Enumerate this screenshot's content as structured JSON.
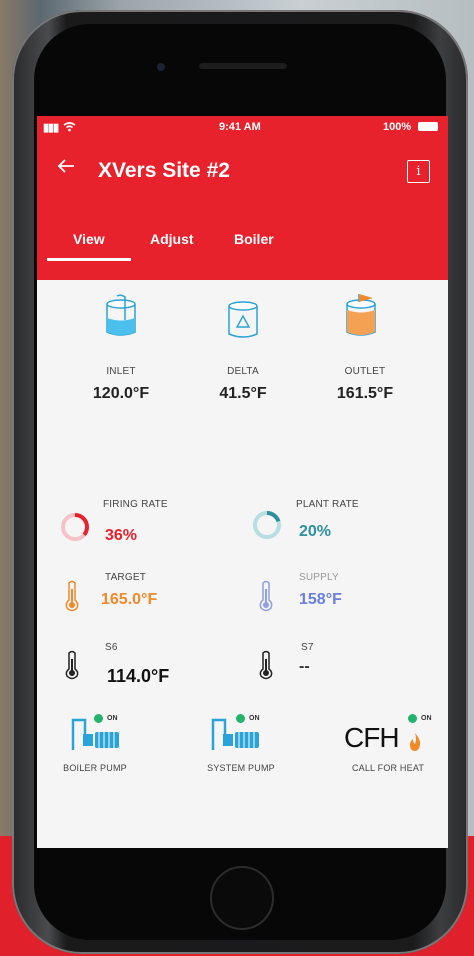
{
  "status_bar": {
    "signal": "▮▮▮",
    "wifi": "wifi",
    "time": "9:41 AM",
    "battery": "100%"
  },
  "header": {
    "title": "XVers Site #2",
    "info_icon": "i"
  },
  "tabs": [
    {
      "label": "View"
    },
    {
      "label": "Adjust"
    },
    {
      "label": "Boiler"
    }
  ],
  "tanks": [
    {
      "label": "INLET",
      "value": "120.0°F",
      "icon": "tank-inlet-icon"
    },
    {
      "label": "DELTA",
      "value": "41.5°F",
      "icon": "tank-delta-icon"
    },
    {
      "label": "OUTLET",
      "value": "161.5°F",
      "icon": "tank-outlet-icon"
    }
  ],
  "rates": [
    {
      "label": "FIRING RATE",
      "value": "36%",
      "fraction": 0.36,
      "color": "#e8222d"
    },
    {
      "label": "PLANT RATE",
      "value": "20%",
      "fraction": 0.2,
      "color": "#2f8ea0"
    }
  ],
  "temps": [
    {
      "label": "TARGET",
      "value": "165.0°F",
      "color": "#f08a2a"
    },
    {
      "label": "SUPPLY",
      "value": "158°F",
      "color": "#6a7fe0"
    },
    {
      "label": "S6",
      "value": "114.0°F",
      "color": "#111111"
    },
    {
      "label": "S7",
      "value": "--",
      "color": "#111111"
    }
  ],
  "devices": [
    {
      "label": "BOILER PUMP",
      "status": "ON"
    },
    {
      "label": "SYSTEM PUMP",
      "status": "ON"
    },
    {
      "label": "CALL FOR HEAT",
      "status": "ON",
      "text": "CFH"
    }
  ]
}
